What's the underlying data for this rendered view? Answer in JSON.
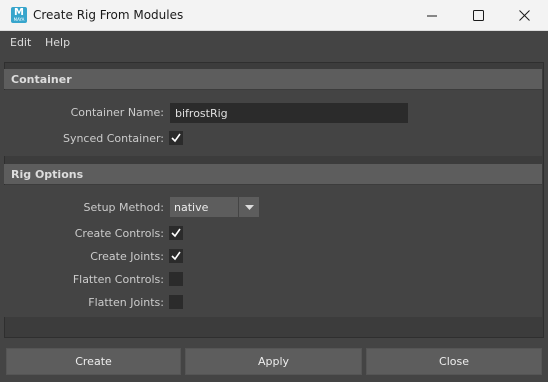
{
  "window": {
    "title": "Create Rig From Modules",
    "icon_letter": "M",
    "icon_sub": "MAYA",
    "icon_color": "#37a5cc"
  },
  "menubar": {
    "items": [
      "Edit",
      "Help"
    ]
  },
  "sections": {
    "container": {
      "title": "Container",
      "container_name_label": "Container Name:",
      "container_name_value": "bifrostRig",
      "synced_container_label": "Synced Container:",
      "synced_container_checked": true
    },
    "rig_options": {
      "title": "Rig Options",
      "setup_method_label": "Setup Method:",
      "setup_method_value": "native",
      "create_controls_label": "Create Controls:",
      "create_controls_checked": true,
      "create_joints_label": "Create Joints:",
      "create_joints_checked": true,
      "flatten_controls_label": "Flatten Controls:",
      "flatten_controls_checked": false,
      "flatten_joints_label": "Flatten Joints:",
      "flatten_joints_checked": false
    }
  },
  "buttons": {
    "create": "Create",
    "apply": "Apply",
    "close": "Close"
  }
}
